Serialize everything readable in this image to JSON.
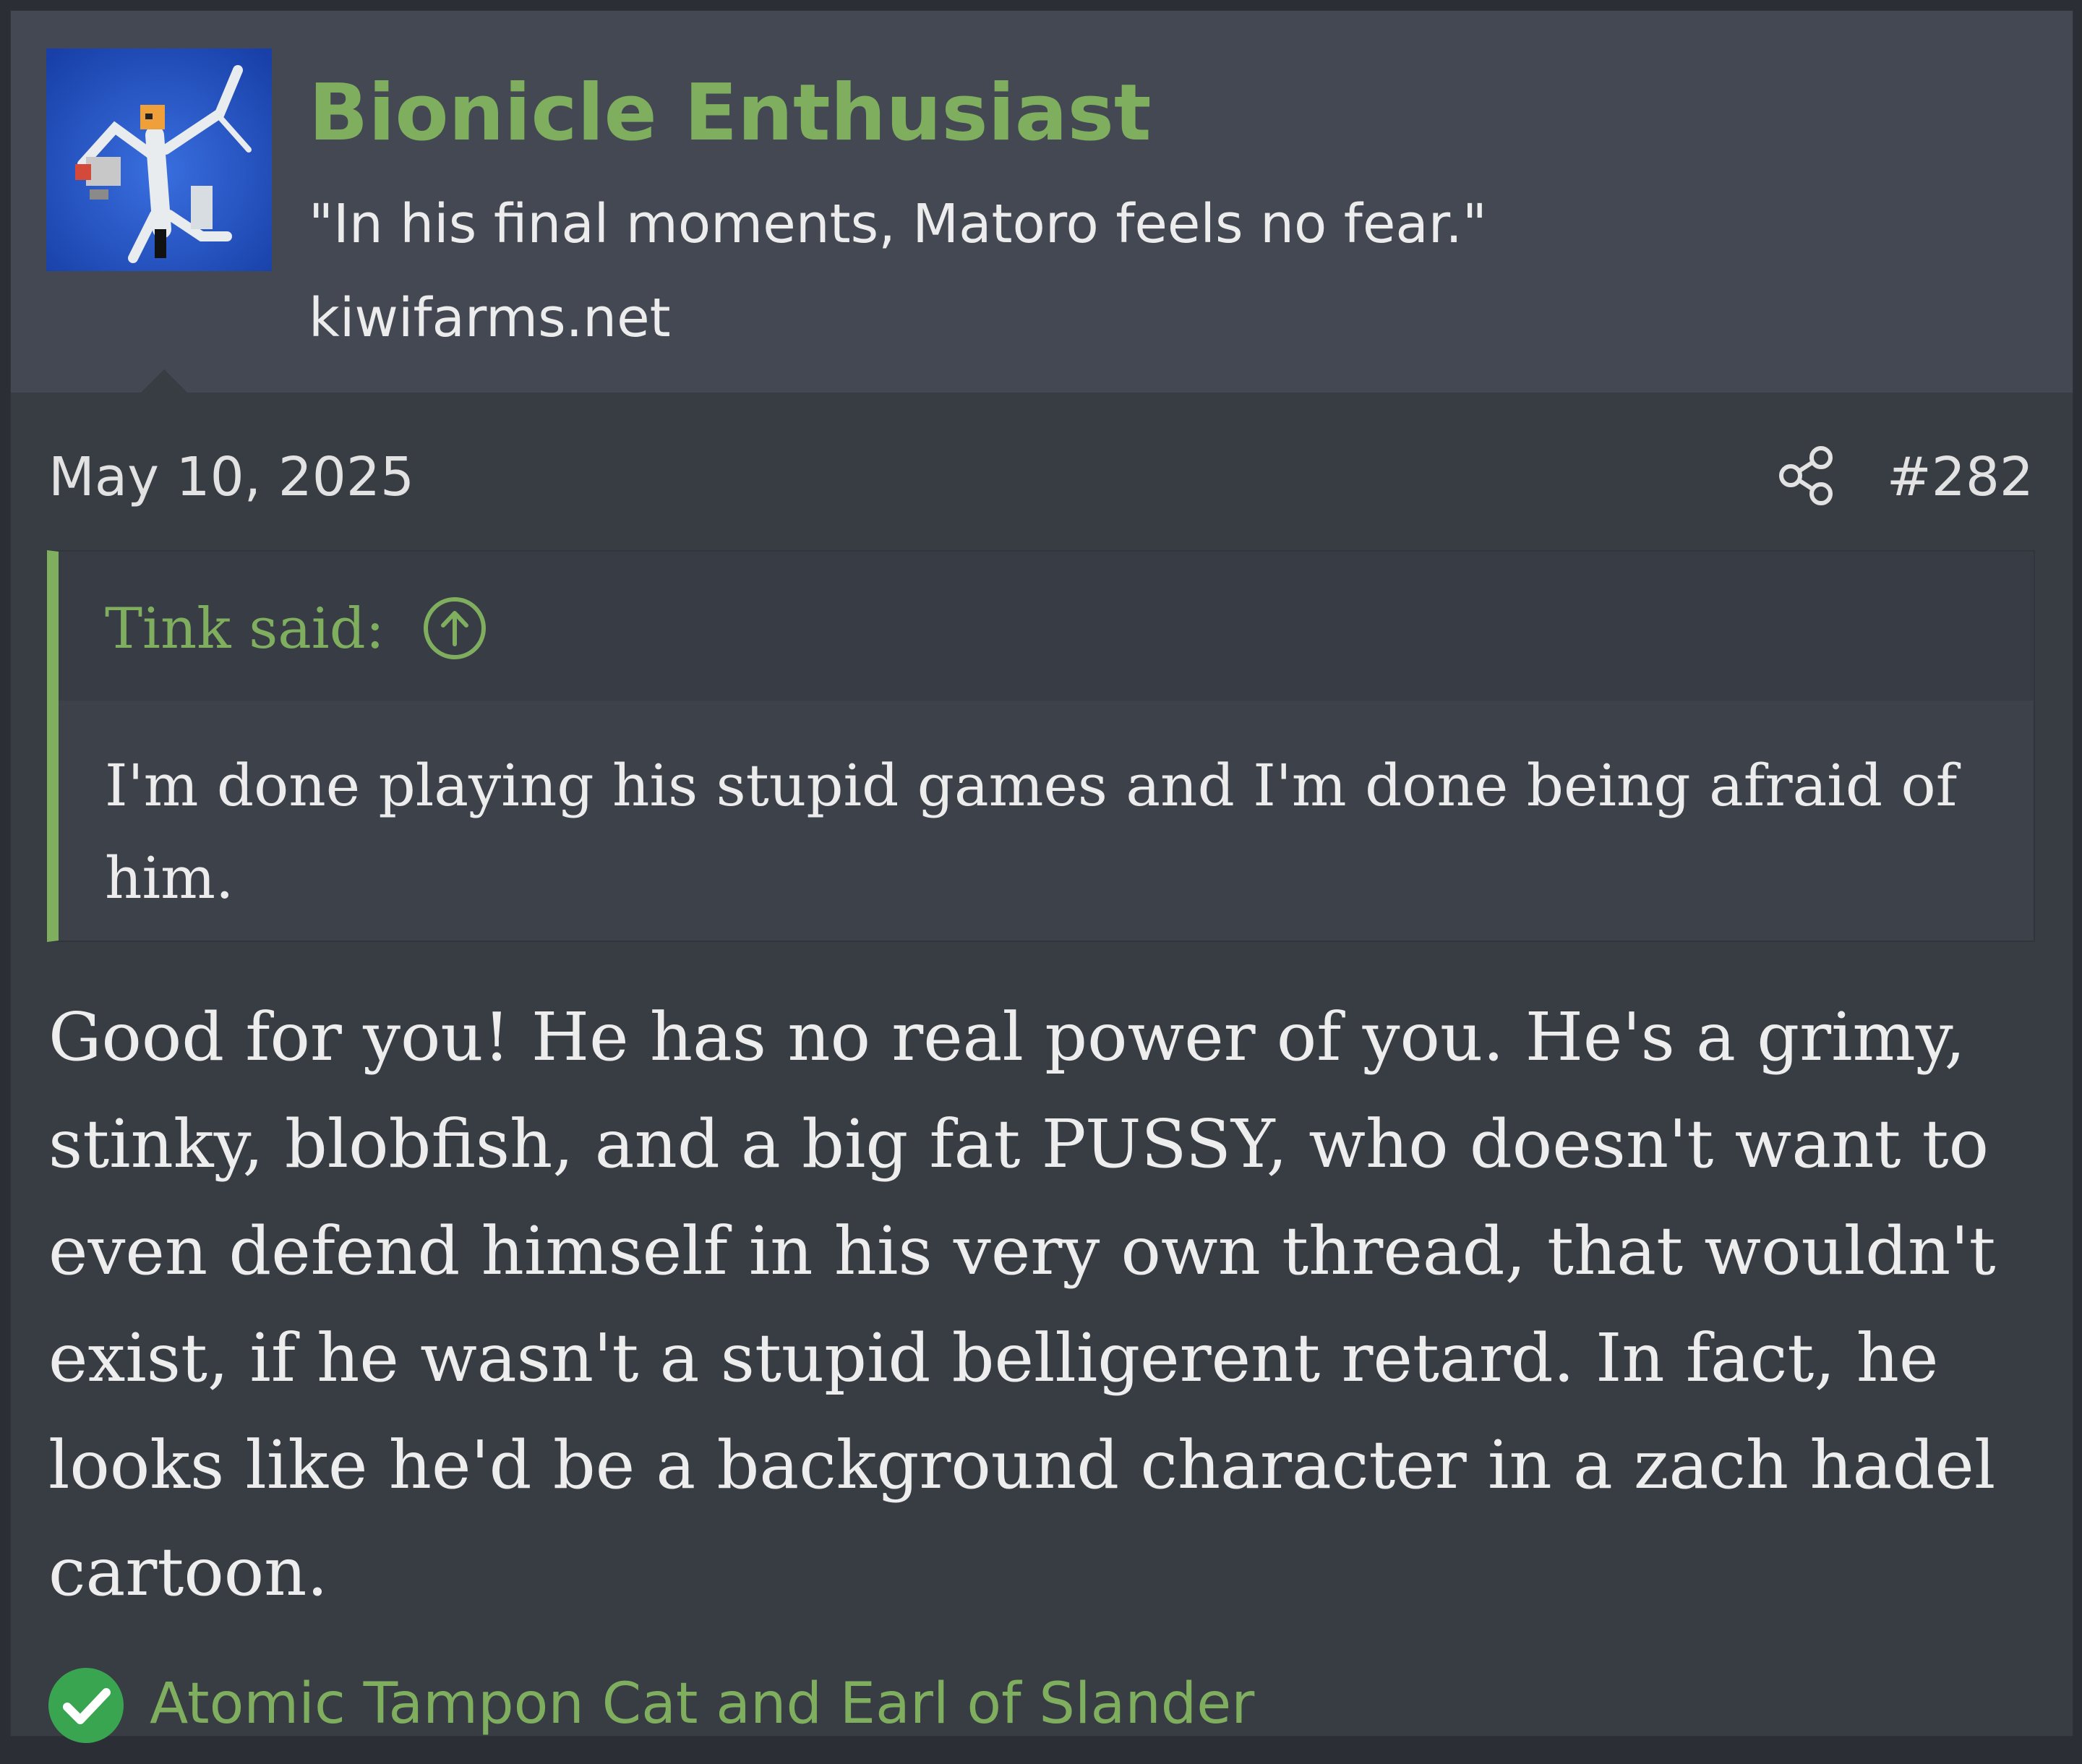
{
  "user": {
    "name": "Bionicle Enthusiast",
    "title": "\"In his final moments, Matoro feels no fear.\"",
    "domain": "kiwifarms.net"
  },
  "post": {
    "date": "May 10, 2025",
    "number": "#282",
    "quote": {
      "author": "Tink said:",
      "text": "I'm done playing his stupid games and I'm done being afraid of him."
    },
    "body": "Good for you! He has no real power of you. He's a grimy, stinky, blobfish, and a big fat PUSSY, who doesn't want to even defend himself in his very own thread, that wouldn't exist, if he wasn't a stupid belligerent retard. In fact, he looks like he'd be a background character in a zach hadel cartoon.",
    "reactions": {
      "icon": "checkmark-icon",
      "names": "Atomic Tampon Cat and Earl of Slander"
    }
  },
  "colors": {
    "accent": "#7fae5e",
    "post_bg": "#383c43",
    "user_block_bg": "#434852",
    "quote_bg": "#3d414a",
    "text": "#ececec",
    "reaction_badge": "#3aa551"
  }
}
